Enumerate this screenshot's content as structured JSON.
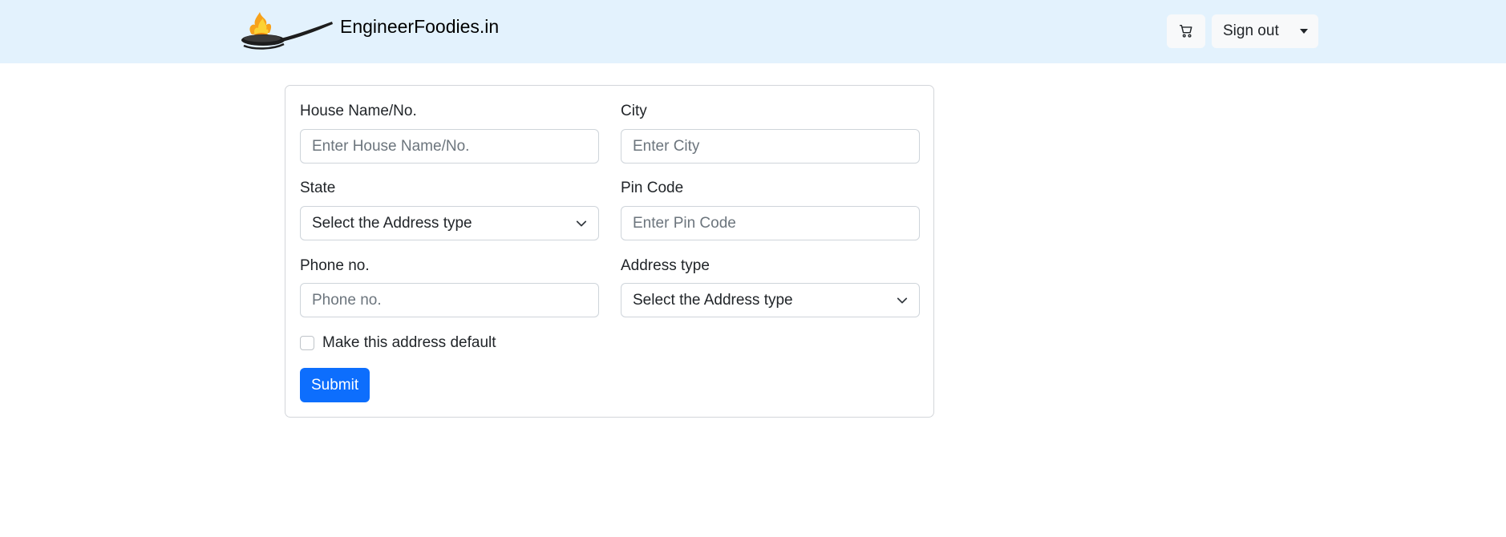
{
  "navbar": {
    "brand_name": "EngineerFoodies.in",
    "logo_icon": "chef-pan-flame-logo",
    "cart_icon": "cart-icon",
    "signout_label": "Sign out",
    "dropdown_icon": "caret-down-icon"
  },
  "form": {
    "house": {
      "label": "House Name/No.",
      "placeholder": "Enter House Name/No."
    },
    "city": {
      "label": "City",
      "placeholder": "Enter City"
    },
    "state": {
      "label": "State",
      "selected": "Select the Address type"
    },
    "pincode": {
      "label": "Pin Code",
      "placeholder": "Enter Pin Code"
    },
    "phone": {
      "label": "Phone no.",
      "placeholder": "Phone no."
    },
    "address_type": {
      "label": "Address type",
      "selected": "Select the Address type"
    },
    "default_checkbox": {
      "label": "Make this address default",
      "checked": false
    },
    "submit_label": "Submit"
  },
  "colors": {
    "navbar_bg": "#e3f2fd",
    "primary": "#0d6efd",
    "border": "#ced4da"
  }
}
